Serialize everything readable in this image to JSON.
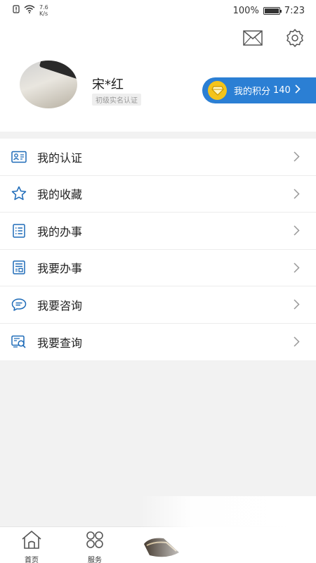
{
  "status_bar": {
    "net_speed_value": "7.6",
    "net_speed_unit": "K/s",
    "battery": "100%",
    "time": "7:23",
    "battery_level": 1.0
  },
  "header": {
    "mail_icon": "mail-icon",
    "settings_icon": "gear-icon"
  },
  "profile": {
    "name": "宋*红",
    "auth_level": "初级实名认证"
  },
  "points": {
    "label": "我的积分",
    "value": "140",
    "accent": "#2b7fd4",
    "coin_color": "#f4c41a"
  },
  "menu": {
    "items": [
      {
        "label": "我的认证",
        "icon": "id-card-icon"
      },
      {
        "label": "我的收藏",
        "icon": "star-icon"
      },
      {
        "label": "我的办事",
        "icon": "list-doc-icon"
      },
      {
        "label": "我要办事",
        "icon": "form-doc-icon"
      },
      {
        "label": "我要咨询",
        "icon": "chat-bubble-icon"
      },
      {
        "label": "我要查询",
        "icon": "search-doc-icon"
      }
    ]
  },
  "tabs": [
    {
      "label": "首页",
      "icon": "home-icon"
    },
    {
      "label": "服务",
      "icon": "grid-icon"
    }
  ],
  "icon_color": "#1e6bb8"
}
